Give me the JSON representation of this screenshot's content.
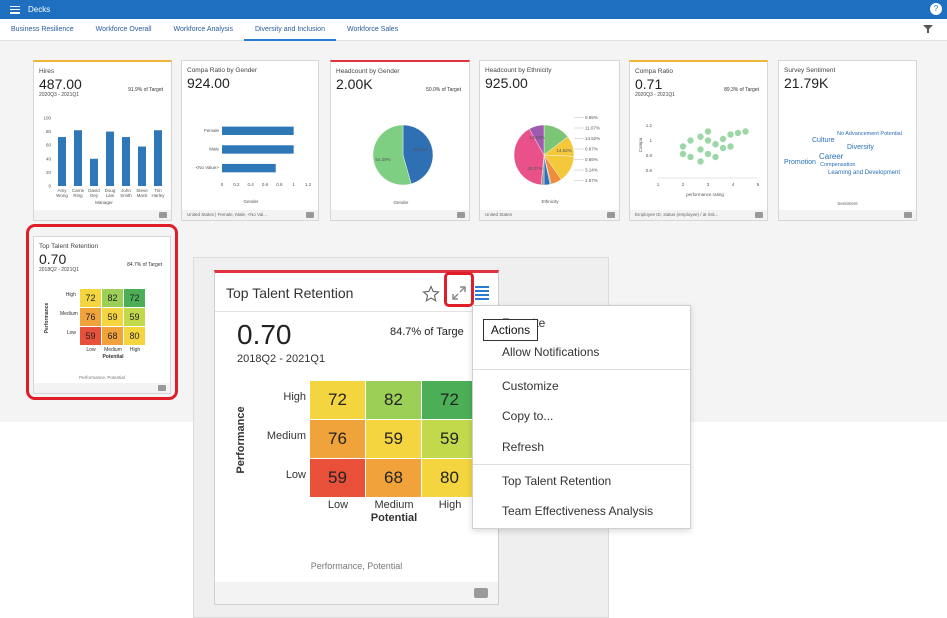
{
  "app": {
    "title": "Decks",
    "help": "?"
  },
  "tabs": [
    {
      "label": "Business Resilience"
    },
    {
      "label": "Workforce Overall"
    },
    {
      "label": "Workforce Analysis"
    },
    {
      "label": "Diversity and Inclusion"
    },
    {
      "label": "Workforce Sales"
    }
  ],
  "cards": {
    "hires": {
      "title": "Hires",
      "value": "487.00",
      "period": "2020Q3 - 2021Q1",
      "target": "91.9% of Target",
      "xlabel": "Manager",
      "chart": {
        "yticks": [
          "100",
          "80",
          "60",
          "40",
          "20",
          "0"
        ],
        "names": [
          "Amy Wong",
          "Carrie Ring",
          "David Oey",
          "Doug Lam",
          "John Smith",
          "Steve Mack",
          "Tim Harley"
        ],
        "name_lines": [
          [
            "Amy",
            "Wong"
          ],
          [
            "Carrie",
            "Ring"
          ],
          [
            "David",
            "Oey"
          ],
          [
            "Doug",
            "Lam"
          ],
          [
            "John",
            "Smith"
          ],
          [
            "Steve",
            "Mack"
          ],
          [
            "Tim",
            "Harley"
          ]
        ],
        "values": [
          72,
          82,
          40,
          80,
          72,
          58,
          82
        ],
        "ymax": 100
      }
    },
    "compa_gender": {
      "title": "Compa Ratio by Gender",
      "value": "924.00",
      "xlabel": "Gender",
      "footer": "United States | Female, Male, <No Val...",
      "chart": {
        "categories": [
          "Female",
          "Male",
          "<No Value>"
        ],
        "values": [
          1.0,
          1.0,
          0.75
        ],
        "xticks": [
          "0",
          "0.2",
          "0.4",
          "0.6",
          "0.8",
          "1",
          "1.2"
        ],
        "xmax": 1.2
      }
    },
    "headcount_gender": {
      "title": "Headcount by Gender",
      "value": "2.00K",
      "target": "50.0% of Target",
      "xlabel": "Gender",
      "chart": {
        "slices": [
          45.61,
          54.39
        ],
        "labels": [
          "45.61%",
          "54.39%"
        ],
        "colors": [
          "#2f6fb3",
          "#7fcf83"
        ]
      }
    },
    "headcount_ethnicity": {
      "title": "Headcount by Ethnicity",
      "value": "925.00",
      "xlabel": "Ethnicity",
      "footer": "United States",
      "chart": {
        "slices": [
          14.63,
          11.07,
          14.52,
          5.97,
          0.65,
          3.14,
          1.57,
          40.27,
          8.18
        ],
        "inner_labels": [
          "14.63%",
          "14.52%",
          "40.27%"
        ],
        "right_labels": [
          "0.65%",
          "11.07%",
          "14.52%",
          "0.97%",
          "0.65%",
          "3.14%",
          "1.57%"
        ],
        "colors": [
          "#7cc576",
          "#f3c83b",
          "#f3c83b",
          "#f08c3a",
          "#6aa9d8",
          "#2f6fb3",
          "#999999",
          "#e8518a",
          "#a05ab0"
        ]
      }
    },
    "compa_ratio": {
      "title": "Compa Ratio",
      "value": "0.71",
      "period": "2020Q3 - 2021Q1",
      "target": "89.3% of Target",
      "xlabel": "performance rating",
      "ylabel": "Compa",
      "footer": "Employee ID, status (employee) / at risk...",
      "chart": {
        "yticks": [
          "1.2",
          "1",
          "0.8",
          "0.6"
        ],
        "xticks": [
          "1",
          "2",
          "3",
          "4",
          "5"
        ],
        "xlim": [
          1,
          5
        ],
        "ylim": [
          0.5,
          1.3
        ],
        "points": [
          [
            2,
            0.82
          ],
          [
            2,
            0.92
          ],
          [
            2.3,
            1.0
          ],
          [
            2.7,
            0.88
          ],
          [
            2.7,
            0.72
          ],
          [
            3,
            1.12
          ],
          [
            3,
            1.0
          ],
          [
            3,
            0.82
          ],
          [
            3.3,
            0.95
          ],
          [
            3.3,
            0.78
          ],
          [
            3.6,
            1.02
          ],
          [
            3.6,
            0.9
          ],
          [
            3.9,
            1.08
          ],
          [
            4.2,
            1.1
          ],
          [
            4.5,
            1.12
          ],
          [
            2.3,
            0.78
          ],
          [
            3.9,
            0.92
          ],
          [
            2.7,
            1.05
          ]
        ]
      }
    },
    "survey": {
      "title": "Survey Sentiment",
      "value": "21.79K",
      "xlabel": "Sentiment",
      "words": [
        {
          "text": "No Advancement Potential"
        },
        {
          "text": "Culture"
        },
        {
          "text": "Diversity"
        },
        {
          "text": "Career"
        },
        {
          "text": "Promotion"
        },
        {
          "text": "Compensation"
        },
        {
          "text": "Learning and Development"
        }
      ]
    },
    "ttr_small": {
      "title": "Top Talent Retention",
      "value": "0.70",
      "period": "2018Q2 - 2021Q1",
      "target": "84.7% of Target",
      "footer_label": "Performance, Potential"
    }
  },
  "expanded": {
    "title": "Top Talent Retention",
    "value": "0.70",
    "period": "2018Q2 - 2021Q1",
    "target": "84.7% of Targe",
    "footer_label": "Performance, Potential"
  },
  "heatmap": {
    "rows": [
      "High",
      "Medium",
      "Low"
    ],
    "cols": [
      "Low",
      "Medium",
      "High"
    ],
    "ylabel": "Performance",
    "xlabel": "Potential",
    "values": [
      [
        72,
        82,
        72
      ],
      [
        76,
        59,
        59
      ],
      [
        59,
        68,
        80
      ]
    ],
    "colors": [
      [
        "#f3d53f",
        "#9ccf55",
        "#4caf57"
      ],
      [
        "#f0a33a",
        "#f4d43f",
        "#c2d94c"
      ],
      [
        "#e8503a",
        "#f2a23a",
        "#f4d43f"
      ]
    ]
  },
  "menu": {
    "items": [
      {
        "label": "Favorite"
      },
      {
        "label": "Allow Notifications"
      },
      {
        "label": "Customize"
      },
      {
        "label": "Copy to..."
      },
      {
        "label": "Refresh"
      },
      {
        "label": "Top Talent Retention"
      },
      {
        "label": "Team Effectiveness Analysis"
      }
    ],
    "tooltip": "Actions"
  },
  "colors": {
    "brand": "#1e6fc0",
    "bar": "#2f78b8",
    "highlight": "#e01e2a"
  }
}
